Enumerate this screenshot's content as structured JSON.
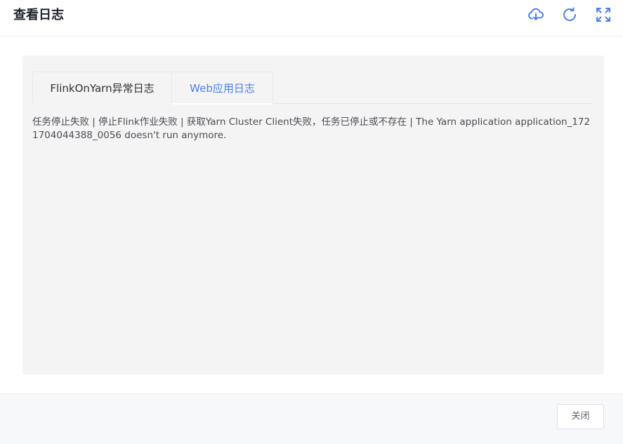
{
  "dialog": {
    "title": "查看日志"
  },
  "toolbar": {
    "download_icon": "cloud-download-icon",
    "refresh_icon": "refresh-icon",
    "fullscreen_icon": "fullscreen-icon",
    "accent_color": "#4c7ee8"
  },
  "tabs": [
    {
      "label": "FlinkOnYarn异常日志",
      "active": false
    },
    {
      "label": "Web应用日志",
      "active": true
    }
  ],
  "log": {
    "text": "任务停止失败 | 停止Flink作业失败 | 获取Yarn Cluster Client失败，任务已停止或不存在 | The Yarn application application_1721704044388_0056 doesn't run anymore."
  },
  "footer": {
    "close_label": "关闭"
  }
}
